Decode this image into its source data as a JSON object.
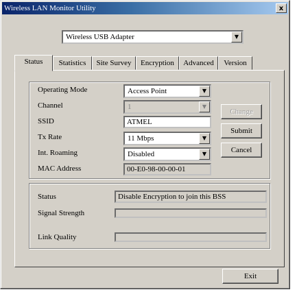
{
  "window": {
    "title": "Wireless LAN Monitor Utility",
    "close_glyph": "x"
  },
  "adapter": {
    "selected": "Wireless USB Adapter"
  },
  "tabs": [
    {
      "label": "Status"
    },
    {
      "label": "Statistics"
    },
    {
      "label": "Site Survey"
    },
    {
      "label": "Encryption"
    },
    {
      "label": "Advanced"
    },
    {
      "label": "Version"
    }
  ],
  "config": {
    "operating_mode": {
      "label": "Operating Mode",
      "value": "Access Point"
    },
    "channel": {
      "label": "Channel",
      "value": "1"
    },
    "ssid": {
      "label": "SSID",
      "value": "ATMEL"
    },
    "tx_rate": {
      "label": "Tx Rate",
      "value": "11 Mbps"
    },
    "int_roaming": {
      "label": "Int. Roaming",
      "value": "Disabled"
    },
    "mac_address": {
      "label": "MAC Address",
      "value": "00-E0-98-00-00-01"
    },
    "change_label": "Change",
    "submit_label": "Submit",
    "cancel_label": "Cancel"
  },
  "status": {
    "status": {
      "label": "Status",
      "value": "Disable Encryption to join this BSS"
    },
    "signal_strength": {
      "label": "Signal Strength"
    },
    "link_quality": {
      "label": "Link Quality"
    }
  },
  "footer": {
    "exit_label": "Exit"
  },
  "colors": {
    "face": "#d4d0c8",
    "title_start": "#0a246a",
    "title_end": "#a6caf0"
  },
  "icons": {
    "dropdown": "chevron-down-icon"
  }
}
